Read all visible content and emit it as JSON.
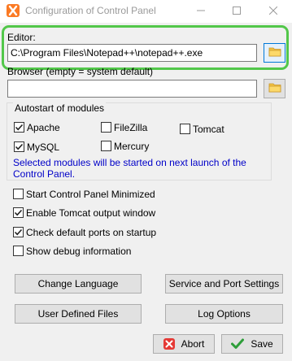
{
  "window": {
    "title": "Configuration of Control Panel",
    "controls": {
      "minimize": "minimize-icon",
      "maximize": "maximize-icon",
      "close": "close-icon"
    }
  },
  "editor": {
    "label": "Editor:",
    "value": "C:\\Program Files\\Notepad++\\notepad++.exe",
    "browse_icon": "folder-icon"
  },
  "browser": {
    "label": "Browser (empty = system default)",
    "value": "",
    "browse_icon": "folder-icon"
  },
  "autostart": {
    "title": "Autostart of modules",
    "modules": [
      {
        "label": "Apache",
        "checked": true
      },
      {
        "label": "FileZilla",
        "checked": false
      },
      {
        "label": "Tomcat",
        "checked": false
      },
      {
        "label": "MySQL",
        "checked": true
      },
      {
        "label": "Mercury",
        "checked": false
      }
    ],
    "note": "Selected modules will be started on next launch of the Control Panel."
  },
  "options": [
    {
      "label": "Start Control Panel Minimized",
      "checked": false
    },
    {
      "label": "Enable Tomcat output window",
      "checked": true
    },
    {
      "label": "Check default ports on startup",
      "checked": true
    },
    {
      "label": "Show debug information",
      "checked": false
    }
  ],
  "buttons": {
    "change_language": "Change Language",
    "service_port": "Service and Port Settings",
    "user_defined": "User Defined Files",
    "log_options": "Log Options",
    "abort": "Abort",
    "save": "Save"
  },
  "colors": {
    "highlight": "#52c74a",
    "note_text": "#0000c8",
    "abort_icon": "#e53935",
    "save_icon": "#2e9e3a"
  }
}
